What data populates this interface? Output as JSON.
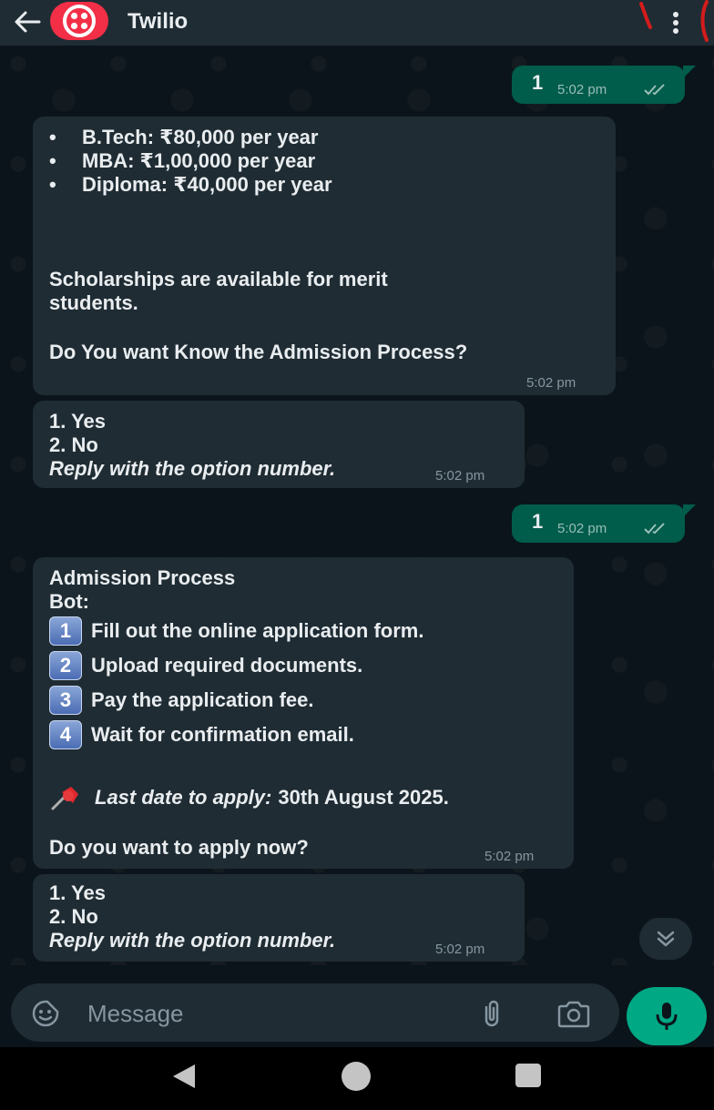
{
  "header": {
    "back_icon": "arrow-left-icon",
    "avatar_icon": "twilio-logo-icon",
    "title": "Twilio",
    "menu_icon": "more-vertical-icon"
  },
  "colors": {
    "header_bg": "#1f2c34",
    "chat_bg": "#0b141a",
    "incoming_bubble": "#1f2c34",
    "outgoing_bubble": "#005c4b",
    "accent_green": "#00a884",
    "twilio_red": "#f22f46"
  },
  "messages": [
    {
      "direction": "out",
      "text": "1",
      "time": "5:02 pm",
      "status": "read"
    },
    {
      "direction": "in",
      "bullets": [
        "B.Tech: ₹80,000 per year",
        "MBA: ₹1,00,000 per year",
        "Diploma: ₹40,000 per year"
      ],
      "bullet_char": "•",
      "text_1": "Scholarships are available for merit",
      "text_2": "students.",
      "question": "Do You want Know the Admission Process?",
      "time": "5:02 pm"
    },
    {
      "direction": "in",
      "options": [
        "1. Yes",
        "2. No"
      ],
      "hint": "Reply with the option number.",
      "time": "5:02 pm"
    },
    {
      "direction": "out",
      "text": "1",
      "time": "5:02 pm",
      "status": "read"
    },
    {
      "direction": "in",
      "title": "Admission Process",
      "subtitle": "Bot:",
      "steps": [
        {
          "num": "1",
          "text": "Fill out the online application form."
        },
        {
          "num": "2",
          "text": "Upload required documents."
        },
        {
          "num": "3",
          "text": "Pay the application fee."
        },
        {
          "num": "4",
          "text": "Wait for confirmation email."
        }
      ],
      "pin_icon": "pushpin-icon",
      "deadline_label": "Last date to apply:",
      "deadline_value": "30th August 2025.",
      "question": "Do you want to apply now?",
      "time": "5:02 pm"
    },
    {
      "direction": "in",
      "options": [
        "1. Yes",
        "2. No"
      ],
      "hint": "Reply with the option number.",
      "time": "5:02 pm"
    }
  ],
  "scroll_down_icon": "double-chevron-down-icon",
  "composer": {
    "placeholder": "Message",
    "emoji_icon": "sticker-smile-icon",
    "attach_icon": "paperclip-icon",
    "camera_icon": "camera-icon",
    "mic_icon": "microphone-icon"
  },
  "navbar": {
    "back_icon": "nav-back-triangle-icon",
    "home_icon": "nav-home-circle-icon",
    "recents_icon": "nav-recents-square-icon"
  }
}
